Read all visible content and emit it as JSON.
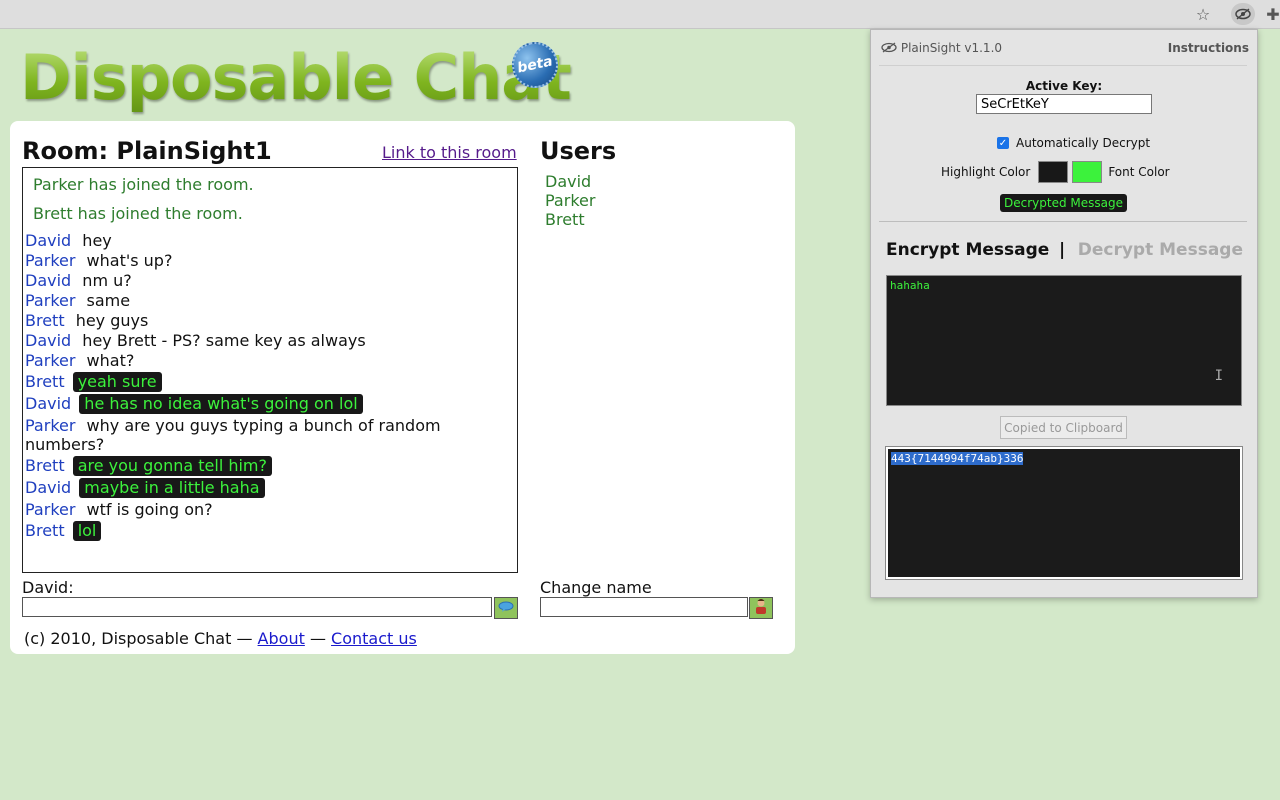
{
  "browser": {
    "star_icon": "star-icon",
    "extension_icon": "eye-icon",
    "puzzle_icon": "puzzle-icon"
  },
  "logo": {
    "text": "Disposable Chat",
    "badge": "beta"
  },
  "room": {
    "title": "Room: PlainSight1",
    "link_label": "Link to this room",
    "system_messages": [
      "Parker has joined the room.",
      "Brett has joined the room."
    ],
    "messages": [
      {
        "user": "David",
        "text": "hey",
        "highlighted": false
      },
      {
        "user": "Parker",
        "text": "what's up?",
        "highlighted": false
      },
      {
        "user": "David",
        "text": "nm u?",
        "highlighted": false
      },
      {
        "user": "Parker",
        "text": "same",
        "highlighted": false
      },
      {
        "user": "Brett",
        "text": "hey guys",
        "highlighted": false
      },
      {
        "user": "David",
        "text": "hey Brett - PS? same key as always",
        "highlighted": false
      },
      {
        "user": "Parker",
        "text": "what?",
        "highlighted": false
      },
      {
        "user": "Brett",
        "text": "yeah sure",
        "highlighted": true
      },
      {
        "user": "David",
        "text": "he has no idea what's going on lol",
        "highlighted": true
      },
      {
        "user": "Parker",
        "text": "why are you guys typing a bunch of random numbers?",
        "highlighted": false
      },
      {
        "user": "Brett",
        "text": "are you gonna tell him?",
        "highlighted": true
      },
      {
        "user": "David",
        "text": "maybe in a little haha",
        "highlighted": true
      },
      {
        "user": "Parker",
        "text": "wtf is going on?",
        "highlighted": false
      },
      {
        "user": "Brett",
        "text": "lol",
        "highlighted": true
      }
    ]
  },
  "users": {
    "heading": "Users",
    "list": [
      "David",
      "Parker",
      "Brett"
    ]
  },
  "compose": {
    "label": "David:",
    "value": "",
    "send_icon": "speech-bubble-icon",
    "change_name_label": "Change name",
    "name_value": "",
    "name_icon": "person-icon"
  },
  "footer": {
    "copyright": "(c) 2010, Disposable Chat —",
    "about": "About",
    "dash": "—",
    "contact": "Contact us"
  },
  "extension": {
    "title": "PlainSight v1.1.0",
    "instructions": "Instructions",
    "active_key_label": "Active Key:",
    "active_key_value": "SeCrEtKeY",
    "auto_decrypt_label": "Automatically Decrypt",
    "auto_decrypt_checked": true,
    "highlight_color_label": "Highlight Color",
    "font_color_label": "Font Color",
    "highlight_color": "#181818",
    "font_color": "#3cf23c",
    "decrypted_badge": "Decrypted Message",
    "tab_encrypt": "Encrypt Message",
    "tab_separator": "|",
    "tab_decrypt": "Decrypt Message",
    "encrypt_input": "hahaha",
    "copied_button": "Copied to Clipboard",
    "encrypt_output": "443{7144994f74ab}336"
  }
}
